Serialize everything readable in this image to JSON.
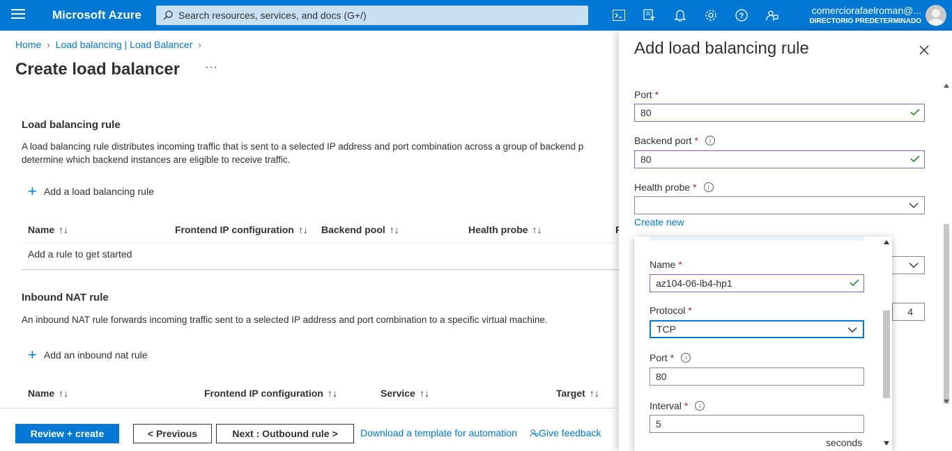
{
  "topbar": {
    "brand": "Microsoft Azure",
    "search_placeholder": "Search resources, services, and docs (G+/)",
    "icons": [
      "cloud-shell-icon",
      "directory-filter-icon",
      "notifications-icon",
      "settings-icon",
      "help-icon",
      "feedback-icon"
    ],
    "account_name": "comerciorafaelroman@...",
    "account_directory": "DIRECTORIO PREDETERMINADO"
  },
  "breadcrumb": [
    "Home",
    "Load balancing | Load Balancer"
  ],
  "page_title": "Create load balancer",
  "more_label": "···",
  "lb_rule": {
    "title": "Load balancing rule",
    "description_line1": "A load balancing rule distributes incoming traffic that is sent to a selected IP address and port combination across a group of backend p",
    "description_line2": "determine which backend instances are eligible to receive traffic.",
    "add_label": "Add a load balancing rule",
    "columns": [
      "Name",
      "Frontend IP configuration",
      "Backend pool",
      "Health probe",
      "F"
    ],
    "empty_text": "Add a rule to get started"
  },
  "nat_rule": {
    "title": "Inbound NAT rule",
    "description": "An inbound NAT rule forwards incoming traffic sent to a selected IP address and port combination to a specific virtual machine.",
    "add_label": "Add an inbound nat rule",
    "columns": [
      "Name",
      "Frontend IP configuration",
      "Service",
      "Target"
    ]
  },
  "footer": {
    "review_create": "Review + create",
    "previous": "< Previous",
    "next": "Next : Outbound rule >",
    "download_template": "Download a template for automation",
    "feedback": "Give feedback"
  },
  "panel": {
    "title": "Add load balancing rule",
    "port_label": "Port",
    "port_value": "80",
    "backend_port_label": "Backend port",
    "backend_port_value": "80",
    "health_probe_label": "Health probe",
    "health_probe_value": "",
    "create_new": "Create new",
    "idle_timeout_value": "4"
  },
  "popup": {
    "name_label": "Name",
    "name_value": "az104-06-lb4-hp1",
    "protocol_label": "Protocol",
    "protocol_value": "TCP",
    "port_label": "Port",
    "port_value": "80",
    "interval_label": "Interval",
    "interval_value": "5",
    "interval_unit": "seconds"
  },
  "colors": {
    "azure_blue": "#0078d4",
    "required": "#a4262c",
    "valid_check": "#107c10"
  }
}
